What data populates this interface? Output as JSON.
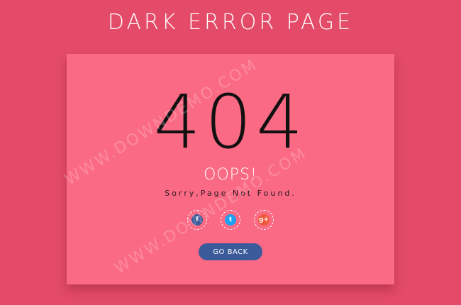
{
  "page": {
    "title": "DARK ERROR PAGE"
  },
  "error": {
    "code": "404",
    "heading": "OOPS!",
    "message": "Sorry,Page Not Found."
  },
  "social": {
    "facebook_glyph": "f",
    "twitter_glyph": "t",
    "googleplus_glyph": "g+"
  },
  "actions": {
    "go_back_label": "GO BACK"
  },
  "watermark": {
    "text": "WWW.DOWNDEMO.COM"
  },
  "colors": {
    "background": "#e44b68",
    "card": "#fb6a84",
    "button": "#3b5a9a",
    "facebook": "#3b5998",
    "twitter": "#1da1f2",
    "googleplus": "#ef5a3b"
  }
}
